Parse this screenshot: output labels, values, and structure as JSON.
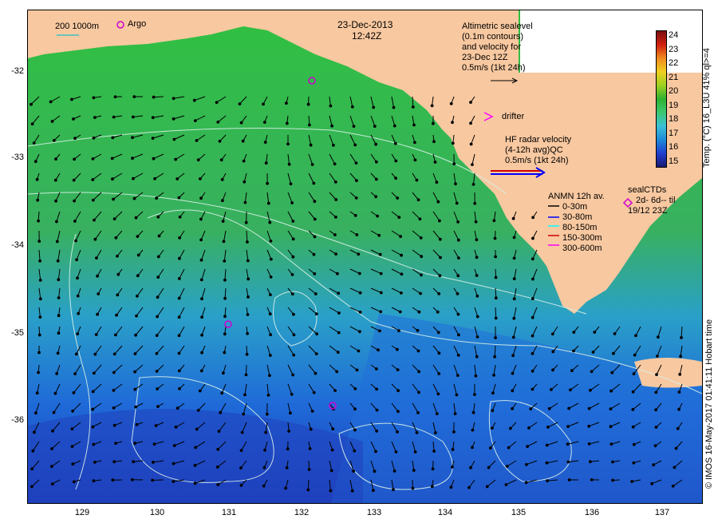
{
  "date": "23-Dec-2013",
  "time": "12:42Z",
  "scale_label": "200  1000m",
  "argo_label": "Argo",
  "altimetry": {
    "line1": "Altimetric sealevel",
    "line2": "(0.1m contours)",
    "line3": "and velocity for",
    "line4": "23-Dec 12Z",
    "line5": "0.5m/s (1kt 24h)"
  },
  "drifter_label": "drifter",
  "hf_radar": {
    "line1": "HF radar velocity",
    "line2": "(4-12h avg)QC",
    "line3": "0.5m/s (1kt 24h)"
  },
  "anmn": {
    "title": "ANMN 12h av.",
    "items": [
      "0-30m",
      "30-80m",
      "80-150m",
      "150-300m",
      "300-600m"
    ],
    "colors": [
      "#000000",
      "#0000ff",
      "#00ffff",
      "#d00000",
      "#ff00ff"
    ]
  },
  "sealctds": {
    "line1": "sealCTDs",
    "line2": "2d- 6d-- til",
    "line3": "19/12 23Z"
  },
  "colorbar": {
    "ticks": [
      "24",
      "23",
      "22",
      "21",
      "20",
      "19",
      "18",
      "17",
      "16",
      "15"
    ],
    "label": "Temp. (°C) 16_L3U 41% ql>=4"
  },
  "y_ticks": [
    "-32",
    "-33",
    "-34",
    "-35",
    "-36"
  ],
  "x_ticks": [
    "129",
    "130",
    "131",
    "132",
    "133",
    "134",
    "135",
    "136",
    "137"
  ],
  "credit": "© IMOS 16-May-2017 01:41:11 Hobart time",
  "colors": {
    "land": "#f8c8a0",
    "ocean_warm": "#2fb030",
    "ocean_cool": "#1f8ad8",
    "ocean_cold": "#1f3fd0",
    "argo": "#d000d0"
  }
}
